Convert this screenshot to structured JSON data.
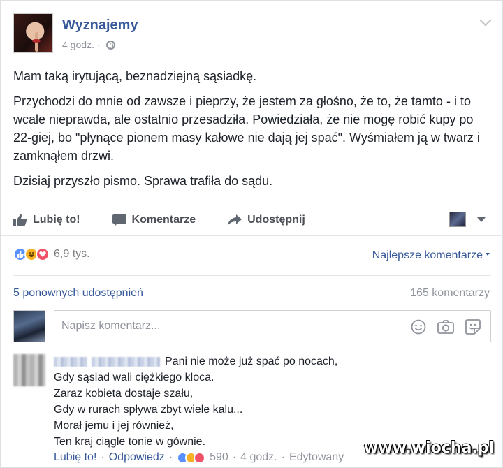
{
  "post": {
    "page_name": "Wyznajemy",
    "time": "4 godz.",
    "separator": "·",
    "paragraphs": [
      "Mam taką irytującą, beznadziejną sąsiadkę.",
      "Przychodzi do mnie od zawsze i pieprzy, że jestem za głośno, że to, że tamto - i to wcale nieprawda, ale ostatnio przesadziła. Powiedziała, że nie mogę robić kupy po 22-giej, bo \"płynące pionem masy kałowe nie dają jej spać\". Wyśmiałem ją w twarz i zamknąłem drzwi.",
      "Dzisiaj przyszło pismo. Sprawa trafiła do sądu."
    ]
  },
  "actions": {
    "like": "Lubię to!",
    "comment": "Komentarze",
    "share": "Udostępnij"
  },
  "reactions": {
    "count": "6,9 tys.",
    "types": [
      "like",
      "haha",
      "love"
    ],
    "best_comments": "Najlepsze komentarze"
  },
  "stats": {
    "shares": "5 ponownych udostępnień",
    "comments": "165 komentarzy"
  },
  "comment_input": {
    "placeholder": "Napisz komentarz..."
  },
  "comment": {
    "lines": [
      "Pani nie może już spać po nocach,",
      "Gdy sąsiad wali ciężkiego kloca.",
      "Zaraz kobieta dostaje szału,",
      "Gdy w rurach spływa zbyt wiele kalu...",
      "Morał jemu i jej również,",
      "Ten kraj ciągle tonie w gównie."
    ],
    "like": "Lubię to!",
    "reply": "Odpowiedz",
    "reaction_count": "590",
    "time": "4 godz.",
    "edited": "Edytowany",
    "dot": "·"
  },
  "watermark": "www.wiocha.pl",
  "colors": {
    "link": "#365899",
    "meta": "#90949c",
    "like": "#5890ff",
    "haha": "#f7b125",
    "love": "#f25268"
  }
}
